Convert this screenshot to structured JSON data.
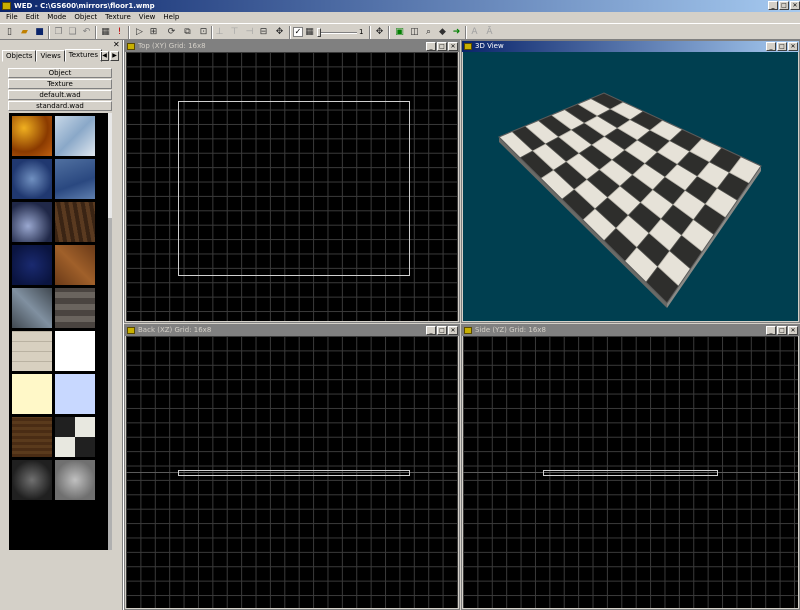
{
  "window": {
    "title": "WED - C:\\GS600\\mirrors\\floor1.wmp",
    "min": "_",
    "max": "□",
    "close": "✕"
  },
  "menu": [
    "File",
    "Edit",
    "Mode",
    "Object",
    "Texture",
    "View",
    "Help"
  ],
  "toolbar": {
    "icons": [
      "new-icon",
      "open-icon",
      "save-icon",
      "copy-icon",
      "paste-icon",
      "delete-icon",
      "undo-icon",
      "build-icon",
      "run-icon",
      "select-icon",
      "move-icon",
      "rotate-icon",
      "scale-icon",
      "align-left-icon",
      "align-center-icon",
      "align-right-icon",
      "align-top-icon",
      "group-icon",
      "ungroup-icon",
      "grid-icon",
      "pan-icon",
      "zoom-icon",
      "find-icon",
      "camera-icon",
      "texture-icon",
      "text-icon",
      "text-alt-icon"
    ],
    "grid_checked": true,
    "zoom_value": "1"
  },
  "left_panel": {
    "close": "✕",
    "tabs": [
      "Objects",
      "Views",
      "Textures"
    ],
    "active_tab": "Textures",
    "categories": [
      "Object",
      "Texture",
      "default.wad",
      "standard.wad"
    ],
    "textures": [
      "lava",
      "ice",
      "blue-water",
      "blue-stone",
      "marble-dark",
      "bark",
      "dark-blue",
      "wood-crate",
      "metal-crate",
      "stone-brick",
      "cream-brick",
      "white",
      "light-yellow",
      "light-blue",
      "dark-wood",
      "checker",
      "cobble-dark",
      "cobble-light"
    ]
  },
  "viewports": [
    {
      "id": "top",
      "title": "Top (XY) Grid: 16x8",
      "active": false
    },
    {
      "id": "3d",
      "title": "3D View",
      "active": true
    },
    {
      "id": "back",
      "title": "Back (XZ) Grid: 16x8",
      "active": false
    },
    {
      "id": "side",
      "title": "Side (YZ) Grid: 16x8",
      "active": false
    }
  ],
  "colors": {
    "titlebar_start": "#0a246a",
    "titlebar_end": "#a6caf0",
    "viewport_bg": "#000000",
    "grid_line": "#3a3a3a",
    "view3d_bg": "#003f50",
    "outline": "#d0d0d0"
  }
}
